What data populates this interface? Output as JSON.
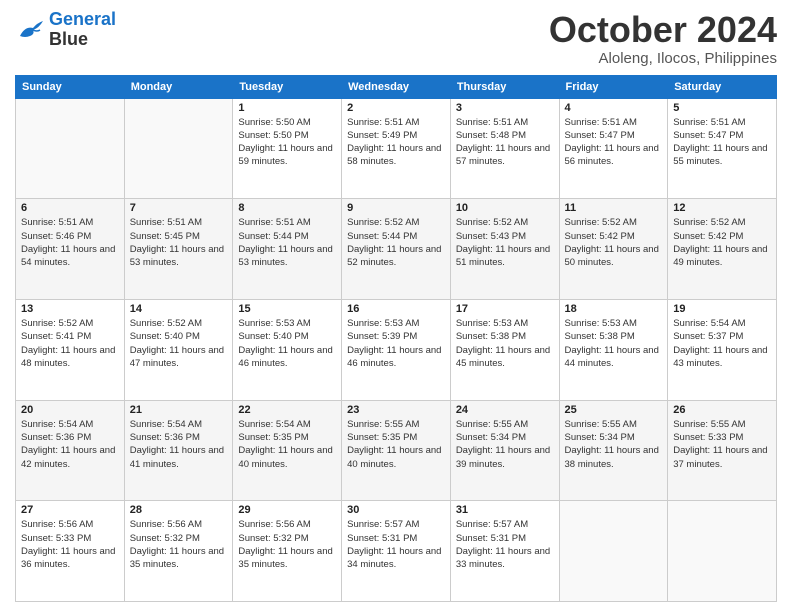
{
  "logo": {
    "line1": "General",
    "line2": "Blue"
  },
  "header": {
    "month": "October 2024",
    "location": "Aloleng, Ilocos, Philippines"
  },
  "weekdays": [
    "Sunday",
    "Monday",
    "Tuesday",
    "Wednesday",
    "Thursday",
    "Friday",
    "Saturday"
  ],
  "weeks": [
    [
      {
        "day": "",
        "sunrise": "",
        "sunset": "",
        "daylight": ""
      },
      {
        "day": "",
        "sunrise": "",
        "sunset": "",
        "daylight": ""
      },
      {
        "day": "1",
        "sunrise": "Sunrise: 5:50 AM",
        "sunset": "Sunset: 5:50 PM",
        "daylight": "Daylight: 11 hours and 59 minutes."
      },
      {
        "day": "2",
        "sunrise": "Sunrise: 5:51 AM",
        "sunset": "Sunset: 5:49 PM",
        "daylight": "Daylight: 11 hours and 58 minutes."
      },
      {
        "day": "3",
        "sunrise": "Sunrise: 5:51 AM",
        "sunset": "Sunset: 5:48 PM",
        "daylight": "Daylight: 11 hours and 57 minutes."
      },
      {
        "day": "4",
        "sunrise": "Sunrise: 5:51 AM",
        "sunset": "Sunset: 5:47 PM",
        "daylight": "Daylight: 11 hours and 56 minutes."
      },
      {
        "day": "5",
        "sunrise": "Sunrise: 5:51 AM",
        "sunset": "Sunset: 5:47 PM",
        "daylight": "Daylight: 11 hours and 55 minutes."
      }
    ],
    [
      {
        "day": "6",
        "sunrise": "Sunrise: 5:51 AM",
        "sunset": "Sunset: 5:46 PM",
        "daylight": "Daylight: 11 hours and 54 minutes."
      },
      {
        "day": "7",
        "sunrise": "Sunrise: 5:51 AM",
        "sunset": "Sunset: 5:45 PM",
        "daylight": "Daylight: 11 hours and 53 minutes."
      },
      {
        "day": "8",
        "sunrise": "Sunrise: 5:51 AM",
        "sunset": "Sunset: 5:44 PM",
        "daylight": "Daylight: 11 hours and 53 minutes."
      },
      {
        "day": "9",
        "sunrise": "Sunrise: 5:52 AM",
        "sunset": "Sunset: 5:44 PM",
        "daylight": "Daylight: 11 hours and 52 minutes."
      },
      {
        "day": "10",
        "sunrise": "Sunrise: 5:52 AM",
        "sunset": "Sunset: 5:43 PM",
        "daylight": "Daylight: 11 hours and 51 minutes."
      },
      {
        "day": "11",
        "sunrise": "Sunrise: 5:52 AM",
        "sunset": "Sunset: 5:42 PM",
        "daylight": "Daylight: 11 hours and 50 minutes."
      },
      {
        "day": "12",
        "sunrise": "Sunrise: 5:52 AM",
        "sunset": "Sunset: 5:42 PM",
        "daylight": "Daylight: 11 hours and 49 minutes."
      }
    ],
    [
      {
        "day": "13",
        "sunrise": "Sunrise: 5:52 AM",
        "sunset": "Sunset: 5:41 PM",
        "daylight": "Daylight: 11 hours and 48 minutes."
      },
      {
        "day": "14",
        "sunrise": "Sunrise: 5:52 AM",
        "sunset": "Sunset: 5:40 PM",
        "daylight": "Daylight: 11 hours and 47 minutes."
      },
      {
        "day": "15",
        "sunrise": "Sunrise: 5:53 AM",
        "sunset": "Sunset: 5:40 PM",
        "daylight": "Daylight: 11 hours and 46 minutes."
      },
      {
        "day": "16",
        "sunrise": "Sunrise: 5:53 AM",
        "sunset": "Sunset: 5:39 PM",
        "daylight": "Daylight: 11 hours and 46 minutes."
      },
      {
        "day": "17",
        "sunrise": "Sunrise: 5:53 AM",
        "sunset": "Sunset: 5:38 PM",
        "daylight": "Daylight: 11 hours and 45 minutes."
      },
      {
        "day": "18",
        "sunrise": "Sunrise: 5:53 AM",
        "sunset": "Sunset: 5:38 PM",
        "daylight": "Daylight: 11 hours and 44 minutes."
      },
      {
        "day": "19",
        "sunrise": "Sunrise: 5:54 AM",
        "sunset": "Sunset: 5:37 PM",
        "daylight": "Daylight: 11 hours and 43 minutes."
      }
    ],
    [
      {
        "day": "20",
        "sunrise": "Sunrise: 5:54 AM",
        "sunset": "Sunset: 5:36 PM",
        "daylight": "Daylight: 11 hours and 42 minutes."
      },
      {
        "day": "21",
        "sunrise": "Sunrise: 5:54 AM",
        "sunset": "Sunset: 5:36 PM",
        "daylight": "Daylight: 11 hours and 41 minutes."
      },
      {
        "day": "22",
        "sunrise": "Sunrise: 5:54 AM",
        "sunset": "Sunset: 5:35 PM",
        "daylight": "Daylight: 11 hours and 40 minutes."
      },
      {
        "day": "23",
        "sunrise": "Sunrise: 5:55 AM",
        "sunset": "Sunset: 5:35 PM",
        "daylight": "Daylight: 11 hours and 40 minutes."
      },
      {
        "day": "24",
        "sunrise": "Sunrise: 5:55 AM",
        "sunset": "Sunset: 5:34 PM",
        "daylight": "Daylight: 11 hours and 39 minutes."
      },
      {
        "day": "25",
        "sunrise": "Sunrise: 5:55 AM",
        "sunset": "Sunset: 5:34 PM",
        "daylight": "Daylight: 11 hours and 38 minutes."
      },
      {
        "day": "26",
        "sunrise": "Sunrise: 5:55 AM",
        "sunset": "Sunset: 5:33 PM",
        "daylight": "Daylight: 11 hours and 37 minutes."
      }
    ],
    [
      {
        "day": "27",
        "sunrise": "Sunrise: 5:56 AM",
        "sunset": "Sunset: 5:33 PM",
        "daylight": "Daylight: 11 hours and 36 minutes."
      },
      {
        "day": "28",
        "sunrise": "Sunrise: 5:56 AM",
        "sunset": "Sunset: 5:32 PM",
        "daylight": "Daylight: 11 hours and 35 minutes."
      },
      {
        "day": "29",
        "sunrise": "Sunrise: 5:56 AM",
        "sunset": "Sunset: 5:32 PM",
        "daylight": "Daylight: 11 hours and 35 minutes."
      },
      {
        "day": "30",
        "sunrise": "Sunrise: 5:57 AM",
        "sunset": "Sunset: 5:31 PM",
        "daylight": "Daylight: 11 hours and 34 minutes."
      },
      {
        "day": "31",
        "sunrise": "Sunrise: 5:57 AM",
        "sunset": "Sunset: 5:31 PM",
        "daylight": "Daylight: 11 hours and 33 minutes."
      },
      {
        "day": "",
        "sunrise": "",
        "sunset": "",
        "daylight": ""
      },
      {
        "day": "",
        "sunrise": "",
        "sunset": "",
        "daylight": ""
      }
    ]
  ]
}
